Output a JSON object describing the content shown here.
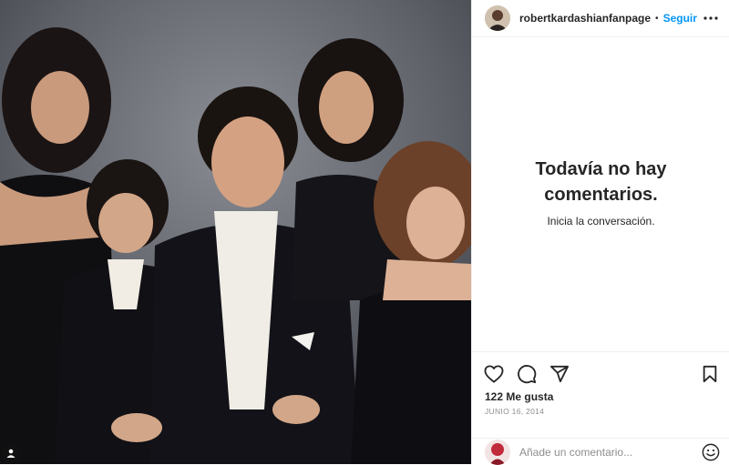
{
  "post": {
    "username": "robertkardashianfanpage",
    "separator": "•",
    "follow_label": "Seguir",
    "empty_title": "Todavía no hay comentarios.",
    "empty_subtitle": "Inicia la conversación.",
    "likes": "122 Me gusta",
    "date": "JUNIO 16, 2014",
    "comment_placeholder": "Añade un comentario..."
  },
  "icons": {
    "more": "more-options-icon",
    "like": "heart-icon",
    "comment": "comment-bubble-icon",
    "share": "paper-plane-icon",
    "save": "bookmark-icon",
    "emoji": "smiley-icon",
    "tag": "user-tag-icon"
  },
  "colors": {
    "accent": "#0095f6",
    "text": "#262626",
    "muted": "#8e8e8e"
  }
}
